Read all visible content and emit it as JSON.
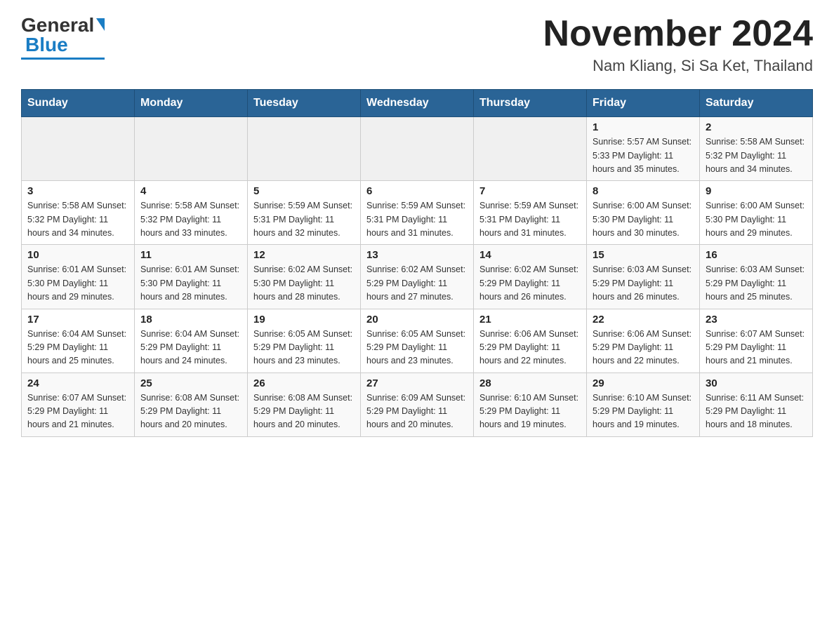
{
  "header": {
    "logo_general": "General",
    "logo_blue": "Blue",
    "month_title": "November 2024",
    "location": "Nam Kliang, Si Sa Ket, Thailand"
  },
  "calendar": {
    "days_of_week": [
      "Sunday",
      "Monday",
      "Tuesday",
      "Wednesday",
      "Thursday",
      "Friday",
      "Saturday"
    ],
    "weeks": [
      [
        {
          "day": "",
          "info": ""
        },
        {
          "day": "",
          "info": ""
        },
        {
          "day": "",
          "info": ""
        },
        {
          "day": "",
          "info": ""
        },
        {
          "day": "",
          "info": ""
        },
        {
          "day": "1",
          "info": "Sunrise: 5:57 AM\nSunset: 5:33 PM\nDaylight: 11 hours and 35 minutes."
        },
        {
          "day": "2",
          "info": "Sunrise: 5:58 AM\nSunset: 5:32 PM\nDaylight: 11 hours and 34 minutes."
        }
      ],
      [
        {
          "day": "3",
          "info": "Sunrise: 5:58 AM\nSunset: 5:32 PM\nDaylight: 11 hours and 34 minutes."
        },
        {
          "day": "4",
          "info": "Sunrise: 5:58 AM\nSunset: 5:32 PM\nDaylight: 11 hours and 33 minutes."
        },
        {
          "day": "5",
          "info": "Sunrise: 5:59 AM\nSunset: 5:31 PM\nDaylight: 11 hours and 32 minutes."
        },
        {
          "day": "6",
          "info": "Sunrise: 5:59 AM\nSunset: 5:31 PM\nDaylight: 11 hours and 31 minutes."
        },
        {
          "day": "7",
          "info": "Sunrise: 5:59 AM\nSunset: 5:31 PM\nDaylight: 11 hours and 31 minutes."
        },
        {
          "day": "8",
          "info": "Sunrise: 6:00 AM\nSunset: 5:30 PM\nDaylight: 11 hours and 30 minutes."
        },
        {
          "day": "9",
          "info": "Sunrise: 6:00 AM\nSunset: 5:30 PM\nDaylight: 11 hours and 29 minutes."
        }
      ],
      [
        {
          "day": "10",
          "info": "Sunrise: 6:01 AM\nSunset: 5:30 PM\nDaylight: 11 hours and 29 minutes."
        },
        {
          "day": "11",
          "info": "Sunrise: 6:01 AM\nSunset: 5:30 PM\nDaylight: 11 hours and 28 minutes."
        },
        {
          "day": "12",
          "info": "Sunrise: 6:02 AM\nSunset: 5:30 PM\nDaylight: 11 hours and 28 minutes."
        },
        {
          "day": "13",
          "info": "Sunrise: 6:02 AM\nSunset: 5:29 PM\nDaylight: 11 hours and 27 minutes."
        },
        {
          "day": "14",
          "info": "Sunrise: 6:02 AM\nSunset: 5:29 PM\nDaylight: 11 hours and 26 minutes."
        },
        {
          "day": "15",
          "info": "Sunrise: 6:03 AM\nSunset: 5:29 PM\nDaylight: 11 hours and 26 minutes."
        },
        {
          "day": "16",
          "info": "Sunrise: 6:03 AM\nSunset: 5:29 PM\nDaylight: 11 hours and 25 minutes."
        }
      ],
      [
        {
          "day": "17",
          "info": "Sunrise: 6:04 AM\nSunset: 5:29 PM\nDaylight: 11 hours and 25 minutes."
        },
        {
          "day": "18",
          "info": "Sunrise: 6:04 AM\nSunset: 5:29 PM\nDaylight: 11 hours and 24 minutes."
        },
        {
          "day": "19",
          "info": "Sunrise: 6:05 AM\nSunset: 5:29 PM\nDaylight: 11 hours and 23 minutes."
        },
        {
          "day": "20",
          "info": "Sunrise: 6:05 AM\nSunset: 5:29 PM\nDaylight: 11 hours and 23 minutes."
        },
        {
          "day": "21",
          "info": "Sunrise: 6:06 AM\nSunset: 5:29 PM\nDaylight: 11 hours and 22 minutes."
        },
        {
          "day": "22",
          "info": "Sunrise: 6:06 AM\nSunset: 5:29 PM\nDaylight: 11 hours and 22 minutes."
        },
        {
          "day": "23",
          "info": "Sunrise: 6:07 AM\nSunset: 5:29 PM\nDaylight: 11 hours and 21 minutes."
        }
      ],
      [
        {
          "day": "24",
          "info": "Sunrise: 6:07 AM\nSunset: 5:29 PM\nDaylight: 11 hours and 21 minutes."
        },
        {
          "day": "25",
          "info": "Sunrise: 6:08 AM\nSunset: 5:29 PM\nDaylight: 11 hours and 20 minutes."
        },
        {
          "day": "26",
          "info": "Sunrise: 6:08 AM\nSunset: 5:29 PM\nDaylight: 11 hours and 20 minutes."
        },
        {
          "day": "27",
          "info": "Sunrise: 6:09 AM\nSunset: 5:29 PM\nDaylight: 11 hours and 20 minutes."
        },
        {
          "day": "28",
          "info": "Sunrise: 6:10 AM\nSunset: 5:29 PM\nDaylight: 11 hours and 19 minutes."
        },
        {
          "day": "29",
          "info": "Sunrise: 6:10 AM\nSunset: 5:29 PM\nDaylight: 11 hours and 19 minutes."
        },
        {
          "day": "30",
          "info": "Sunrise: 6:11 AM\nSunset: 5:29 PM\nDaylight: 11 hours and 18 minutes."
        }
      ]
    ]
  }
}
